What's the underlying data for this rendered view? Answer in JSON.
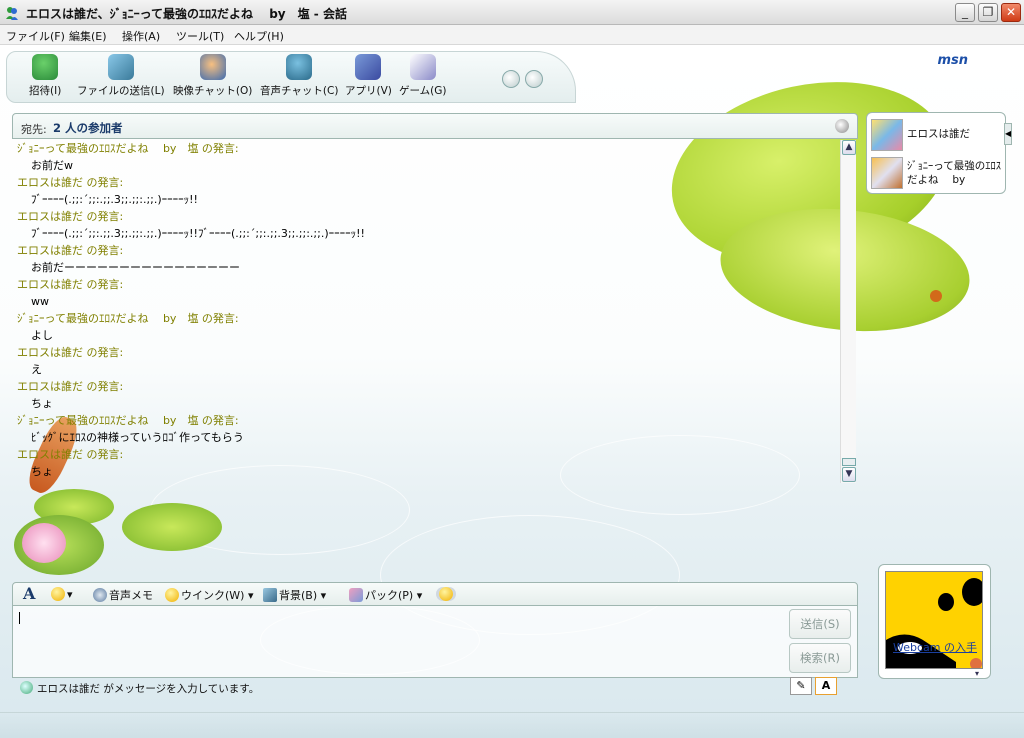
{
  "window": {
    "title": "エロスは誰だ、ｼﾞｮﾆｰって最強のｴﾛｽだよね　 by　塩 - 会話",
    "controls": {
      "minimize": "_",
      "maximize": "❐",
      "close": "✕"
    }
  },
  "menu": {
    "items": [
      "ファイル(F)",
      "編集(E)",
      "操作(A)",
      "ツール(T)",
      "ヘルプ(H)"
    ]
  },
  "toolbar": {
    "buttons": [
      {
        "label": "招待(I)",
        "icon": "invite-icon"
      },
      {
        "label": "ファイルの送信(L)",
        "icon": "send-file-icon"
      },
      {
        "label": "映像チャット(O)",
        "icon": "video-chat-icon"
      },
      {
        "label": "音声チャット(C)",
        "icon": "voice-chat-icon"
      },
      {
        "label": "アプリ(V)",
        "icon": "apps-icon"
      },
      {
        "label": "ゲーム(G)",
        "icon": "games-icon"
      }
    ],
    "brand": "msn"
  },
  "to_bar": {
    "label": "宛先:",
    "participants": "2 人の参加者"
  },
  "conversation": [
    {
      "sender": "ｼﾞｮﾆｰって最強のｴﾛｽだよね　 by　塩 の発言:",
      "text": "お前だw"
    },
    {
      "sender": "エロスは誰だ の発言:",
      "text": "ﾌﾞｰｰｰｰ(.;;:´;;:.;;.3;;.;;:.;;.)ｰｰｰｰｯ!!"
    },
    {
      "sender": "エロスは誰だ の発言:",
      "text": "ﾌﾞｰｰｰｰ(.;;:´;;:.;;.3;;.;;:.;;.)ｰｰｰｰｯ!!ﾌﾞｰｰｰｰ(.;;:´;;:.;;.3;;.;;:.;;.)ｰｰｰｰｯ!!"
    },
    {
      "sender": "エロスは誰だ の発言:",
      "text": "お前だーーーーーーーーーーーーーーーー"
    },
    {
      "sender": "エロスは誰だ の発言:",
      "text": "ww"
    },
    {
      "sender": "ｼﾞｮﾆｰって最強のｴﾛｽだよね　 by　塩 の発言:",
      "text": "よし"
    },
    {
      "sender": "エロスは誰だ の発言:",
      "text": "え"
    },
    {
      "sender": "エロスは誰だ の発言:",
      "text": "ちょ"
    },
    {
      "sender": "ｼﾞｮﾆｰって最強のｴﾛｽだよね　 by　塩 の発言:",
      "text": "ﾋﾞｯｸﾞにｴﾛｽの神様っていうﾛｺﾞ作ってもらう"
    },
    {
      "sender": "エロスは誰だ の発言:",
      "text": "ちょ"
    }
  ],
  "participants_list": [
    {
      "name": "エロスは誰だ"
    },
    {
      "name": "ｼﾞｮﾆｰって最強のｴﾛｽだよね　 by"
    }
  ],
  "format_bar": {
    "font_icon": "A",
    "voice_memo": "音声メモ",
    "wink": "ウインク(W)",
    "background": "背景(B)",
    "pack": "パック(P)"
  },
  "input": {
    "send_label": "送信(S)",
    "search_label": "検索(R)"
  },
  "status": {
    "typing": "エロスは誰だ がメッセージを入力しています。"
  },
  "avatar": {
    "webcam_link": "Webcam の入手"
  },
  "colors": {
    "sender_text": "#808000",
    "accent_border": "#9fb6b0",
    "close_button": "#cf3b16",
    "link": "#1a3fa0"
  }
}
